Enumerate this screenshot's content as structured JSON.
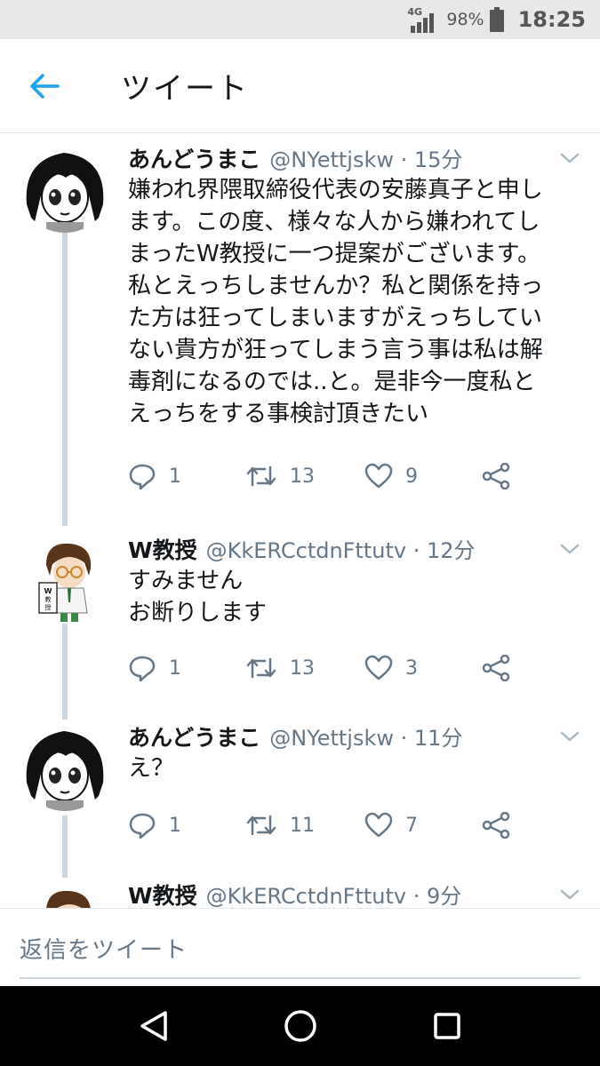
{
  "status_bar": {
    "network": "4G",
    "battery": "98%",
    "time": "18:25"
  },
  "app_bar": {
    "title": "ツイート",
    "back_icon": "arrow-left-icon",
    "accent": "#1da1f2"
  },
  "tweets": [
    {
      "name": "あんどうまこ",
      "handle": "@NYettjskw · 15分",
      "lines": [
        "嫌われ界隈取締役代表の安藤真子と申し",
        "ます。この度、様々な人から嫌われてし",
        "まったW教授に一つ提案がございます。",
        "私とえっちしませんか？私と関係を持っ",
        "た方は狂ってしまいますがえっちしてい",
        "ない貴方が狂ってしまう言う事は私は解",
        "毒剤になるのでは..と。是非今一度私と",
        "えっちをする事検討頂きたい"
      ],
      "replies": "1",
      "retweets": "13",
      "likes": "9"
    },
    {
      "name": "W教授",
      "handle": "@KkERCctdnFttutv · 12分",
      "lines": [
        "すみません",
        "お断りします"
      ],
      "replies": "1",
      "retweets": "13",
      "likes": "3",
      "avatar_text": "W教授"
    },
    {
      "name": "あんどうまこ",
      "handle": "@NYettjskw · 11分",
      "lines": [
        "え？"
      ],
      "replies": "1",
      "retweets": "11",
      "likes": "7"
    },
    {
      "name": "W教授",
      "handle": "@KkERCctdnFttutv · 9分"
    }
  ],
  "reply_box": {
    "placeholder": "返信をツイート"
  },
  "nav_bar": {
    "back": "triangle-back-icon",
    "home": "circle-home-icon",
    "recents": "square-recents-icon"
  }
}
